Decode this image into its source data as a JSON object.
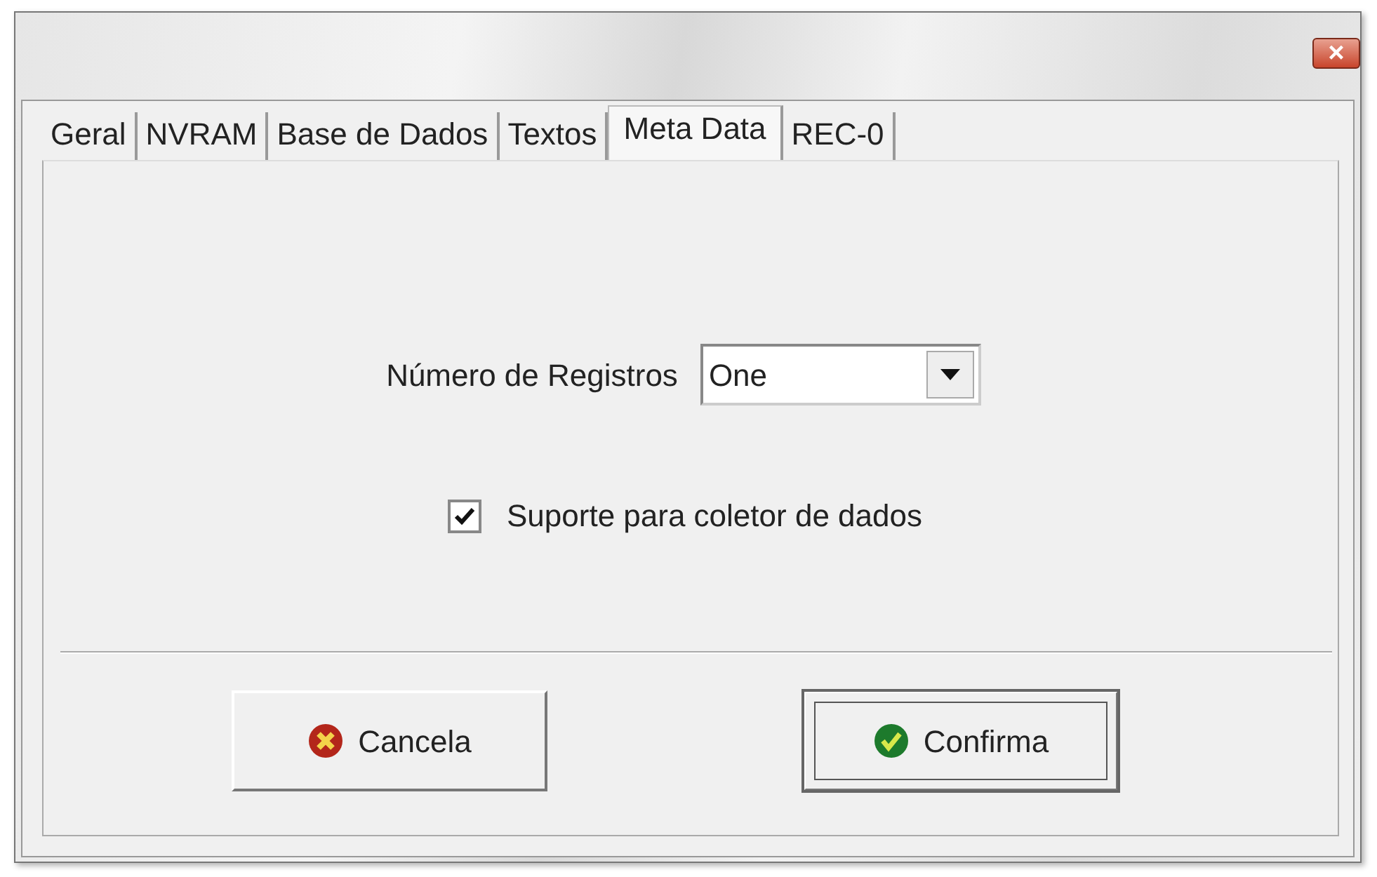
{
  "window": {
    "close_button": "×"
  },
  "tabs": [
    {
      "label": "Geral",
      "selected": false
    },
    {
      "label": "NVRAM",
      "selected": false
    },
    {
      "label": "Base de Dados",
      "selected": false
    },
    {
      "label": "Textos",
      "selected": false
    },
    {
      "label": "Meta Data",
      "selected": true
    },
    {
      "label": "REC-0",
      "selected": false
    }
  ],
  "fields": {
    "label": "Número de Registros",
    "value": "One"
  },
  "checkbox": {
    "label": "Suporte para coletor de dados",
    "checked": true
  },
  "buttons": [
    {
      "label": "Cancela",
      "kind": "cancel",
      "default": false
    },
    {
      "label": "Confirma",
      "kind": "confirm",
      "default": true
    }
  ]
}
